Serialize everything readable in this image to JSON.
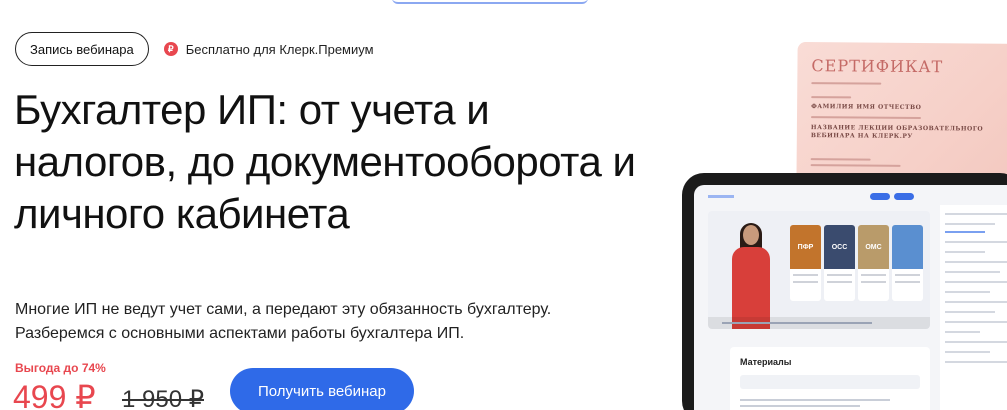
{
  "header": {
    "tag_label": "Запись вебинара",
    "premium_label": "Бесплатно для Клерк.Премиум",
    "premium_icon": "klerk-premium-icon"
  },
  "main": {
    "title": "Бухгалтер ИП: от учета и налогов, до документооборота и личного кабинета",
    "description": "Многие ИП не ведут учет сами, а передают эту обязанность бухгалтеру. Разберемся с основными аспектами работы бухгалтера ИП."
  },
  "pricing": {
    "discount": "Выгода до 74%",
    "price": "499 ₽",
    "old_price": "1 950 ₽",
    "cta_label": "Получить вебинар"
  },
  "certificate": {
    "title": "СЕРТИФИКАТ",
    "name_placeholder": "ФАМИЛИЯ ИМЯ ОТЧЕСТВО",
    "course_line1": "НАЗВАНИЕ ЛЕКЦИИ ОБРАЗОВАТЕЛЬНОГО",
    "course_line2": "ВЕБИНАРА НА КЛЕРК.РУ"
  },
  "tablet": {
    "cards": [
      {
        "label": "ПФР",
        "color": "#c2742c"
      },
      {
        "label": "ОСС",
        "color": "#3a4b6e"
      },
      {
        "label": "ОМС",
        "color": "#b99b6a"
      },
      {
        "label": "",
        "color": "#5a8fd0"
      }
    ],
    "materials_title": "Материалы"
  },
  "colors": {
    "accent": "#2f6ae8",
    "price": "#e8474f"
  }
}
